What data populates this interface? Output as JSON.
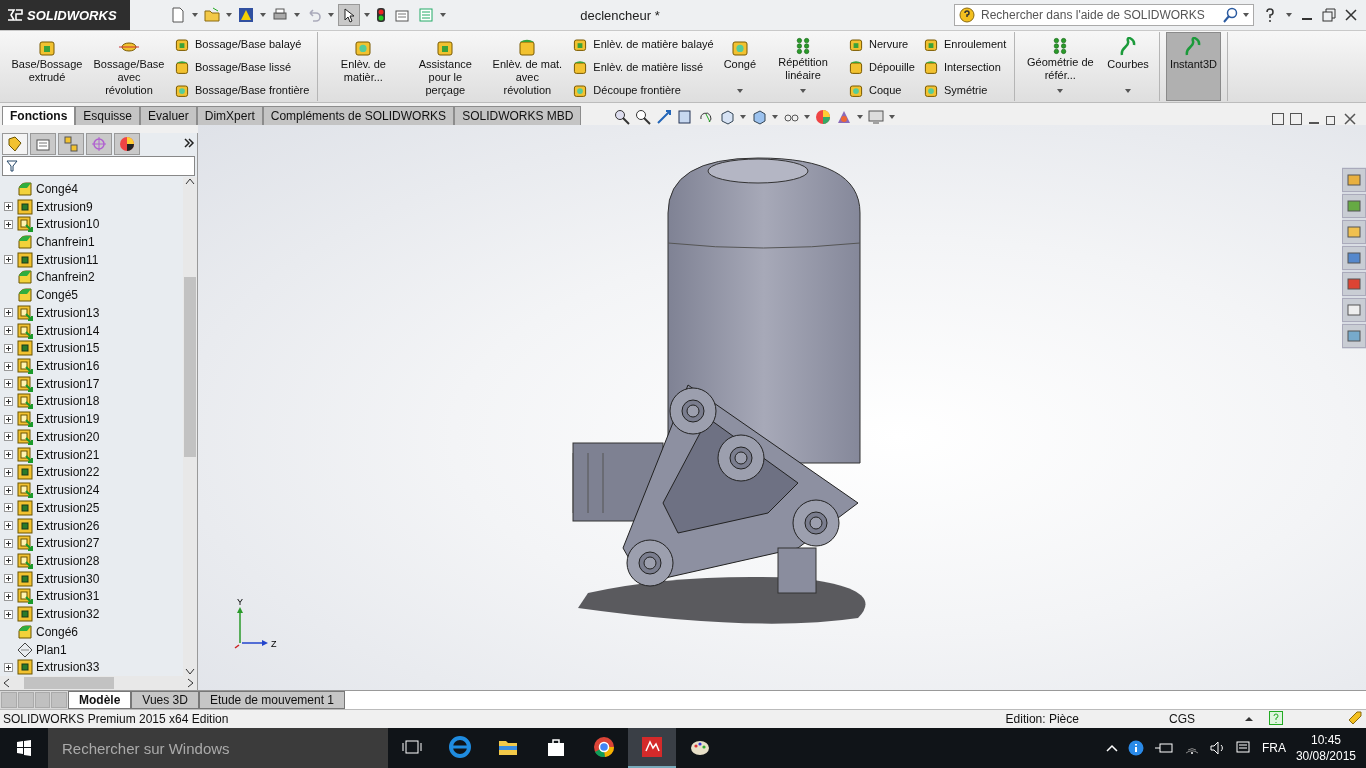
{
  "titlebar": {
    "logo": "SOLIDWORKS",
    "document": "declencheur *",
    "search_placeholder": "Rechercher dans l'aide de SOLIDWORKS"
  },
  "ribbon": {
    "groups": [
      {
        "items": [
          {
            "kind": "large",
            "label": "Base/Bossage extrudé",
            "dropdown": false,
            "on": false
          },
          {
            "kind": "large",
            "label": "Bossage/Base avec révolution",
            "dropdown": false,
            "on": false
          },
          {
            "kind": "stack",
            "entries": [
              "Bossage/Base balayé",
              "Bossage/Base lissé",
              "Bossage/Base frontière"
            ]
          }
        ]
      },
      {
        "items": [
          {
            "kind": "large",
            "label": "Enlèv. de matièr...",
            "dropdown": false,
            "on": false
          },
          {
            "kind": "large",
            "label": "Assistance pour le perçage",
            "dropdown": false,
            "on": false
          },
          {
            "kind": "large",
            "label": "Enlèv. de mat. avec révolution",
            "dropdown": false,
            "on": false
          },
          {
            "kind": "stack",
            "entries": [
              "Enlèv. de matière balayé",
              "Enlèv. de matière lissé",
              "Découpe frontière"
            ]
          },
          {
            "kind": "large",
            "label": "Congé",
            "dropdown": true,
            "on": false
          },
          {
            "kind": "large",
            "label": "Répétition linéaire",
            "dropdown": true,
            "on": false
          },
          {
            "kind": "stack",
            "entries": [
              "Nervure",
              "Dépouille",
              "Coque"
            ]
          },
          {
            "kind": "stack",
            "entries": [
              "Enroulement",
              "Intersection",
              "Symétrie"
            ]
          }
        ]
      },
      {
        "items": [
          {
            "kind": "large",
            "label": "Géométrie de référ...",
            "dropdown": true,
            "on": false
          },
          {
            "kind": "large",
            "label": "Courbes",
            "dropdown": true,
            "on": false
          }
        ]
      },
      {
        "items": [
          {
            "kind": "large",
            "label": "Instant3D",
            "dropdown": false,
            "on": true
          }
        ]
      }
    ]
  },
  "command_tabs": [
    {
      "label": "Fonctions",
      "selected": true
    },
    {
      "label": "Esquisse",
      "selected": false
    },
    {
      "label": "Evaluer",
      "selected": false
    },
    {
      "label": "DimXpert",
      "selected": false
    },
    {
      "label": "Compléments de SOLIDWORKS",
      "selected": false
    },
    {
      "label": "SOLIDWORKS MBD",
      "selected": false
    }
  ],
  "feature_tree": [
    {
      "label": "Congé4",
      "kind": "fillet",
      "expandable": false
    },
    {
      "label": "Extrusion9",
      "kind": "cut",
      "expandable": true
    },
    {
      "label": "Extrusion10",
      "kind": "boss",
      "expandable": true
    },
    {
      "label": "Chanfrein1",
      "kind": "fillet",
      "expandable": false
    },
    {
      "label": "Extrusion11",
      "kind": "cut",
      "expandable": true
    },
    {
      "label": "Chanfrein2",
      "kind": "fillet",
      "expandable": false
    },
    {
      "label": "Congé5",
      "kind": "fillet",
      "expandable": false
    },
    {
      "label": "Extrusion13",
      "kind": "boss",
      "expandable": true
    },
    {
      "label": "Extrusion14",
      "kind": "boss",
      "expandable": true
    },
    {
      "label": "Extrusion15",
      "kind": "cut",
      "expandable": true
    },
    {
      "label": "Extrusion16",
      "kind": "boss",
      "expandable": true
    },
    {
      "label": "Extrusion17",
      "kind": "boss",
      "expandable": true
    },
    {
      "label": "Extrusion18",
      "kind": "boss",
      "expandable": true
    },
    {
      "label": "Extrusion19",
      "kind": "boss",
      "expandable": true
    },
    {
      "label": "Extrusion20",
      "kind": "boss",
      "expandable": true
    },
    {
      "label": "Extrusion21",
      "kind": "boss",
      "expandable": true
    },
    {
      "label": "Extrusion22",
      "kind": "cut",
      "expandable": true
    },
    {
      "label": "Extrusion24",
      "kind": "boss",
      "expandable": true
    },
    {
      "label": "Extrusion25",
      "kind": "cut",
      "expandable": true
    },
    {
      "label": "Extrusion26",
      "kind": "cut",
      "expandable": true
    },
    {
      "label": "Extrusion27",
      "kind": "boss",
      "expandable": true
    },
    {
      "label": "Extrusion28",
      "kind": "boss",
      "expandable": true
    },
    {
      "label": "Extrusion30",
      "kind": "cut",
      "expandable": true
    },
    {
      "label": "Extrusion31",
      "kind": "boss",
      "expandable": true
    },
    {
      "label": "Extrusion32",
      "kind": "cut",
      "expandable": true
    },
    {
      "label": "Congé6",
      "kind": "fillet",
      "expandable": false
    },
    {
      "label": "Plan1",
      "kind": "plane",
      "expandable": false
    },
    {
      "label": "Extrusion33",
      "kind": "cut",
      "expandable": true
    }
  ],
  "viewport": {
    "triad_labels": [
      "Y",
      "Z"
    ]
  },
  "bottom_tabs": [
    {
      "label": "Modèle",
      "selected": true
    },
    {
      "label": "Vues 3D",
      "selected": false
    },
    {
      "label": "Etude de mouvement 1",
      "selected": false
    }
  ],
  "status_bar": {
    "product": "SOLIDWORKS Premium 2015 x64 Edition",
    "mode": "Edition: Pièce",
    "units": "CGS"
  },
  "taskbar": {
    "search_placeholder": "Rechercher sur Windows",
    "language": "FRA",
    "time": "10:45",
    "date": "30/08/2015"
  }
}
